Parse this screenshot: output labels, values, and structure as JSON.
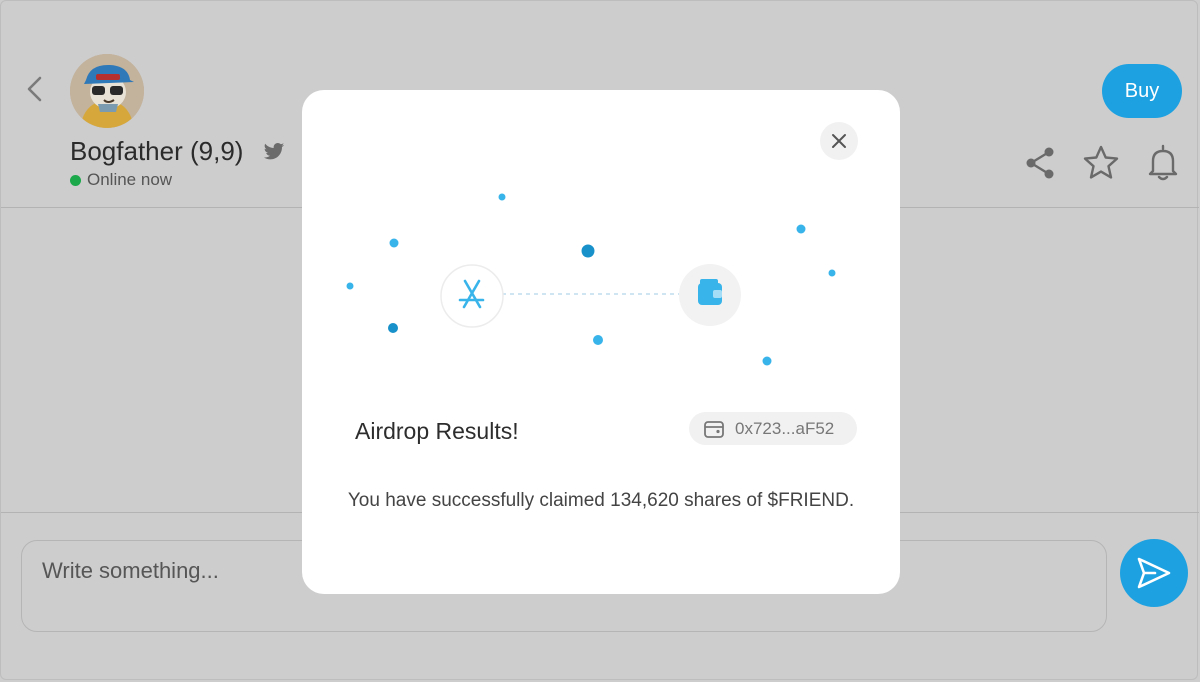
{
  "header": {
    "username": "Bogfather (9,9)",
    "status_text": "Online now",
    "buy_label": "Buy"
  },
  "composer": {
    "placeholder": "Write something..."
  },
  "modal": {
    "title": "Airdrop Results!",
    "wallet_address": "0x723...aF52",
    "message": "You have successfully claimed 134,620 shares of $FRIEND."
  },
  "icons": [
    "back-chevron-icon",
    "twitter-icon",
    "share-icon",
    "star-icon",
    "bell-icon",
    "send-icon",
    "close-icon",
    "app-store-icon",
    "wallet-icon"
  ],
  "colors": {
    "accent": "#1ea1e0",
    "online": "#1aa84a",
    "overlay": "#cdcdcd",
    "modal_bg": "#ffffff"
  }
}
